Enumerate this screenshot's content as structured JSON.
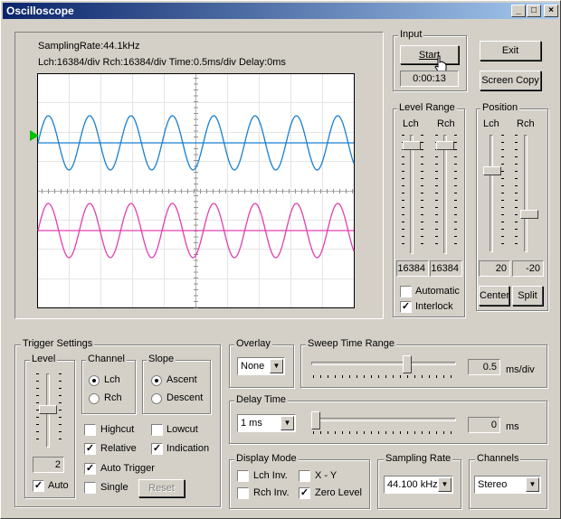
{
  "window": {
    "title": "Oscilloscope"
  },
  "titlebar_buttons": {
    "minimize": "_",
    "maximize": "□",
    "close": "×"
  },
  "scope": {
    "line1": "SamplingRate:44.1kHz",
    "line2": "Lch:16384/div  Rch:16384/div  Time:0.5ms/div  Delay:0ms",
    "colors": {
      "lch": "#1a7fd0",
      "rch": "#e040b0",
      "trigger_marker": "#00c000"
    }
  },
  "input": {
    "label": "Input",
    "start_button": "Start",
    "elapsed": "0:00:13"
  },
  "actions": {
    "exit_button": "Exit",
    "screen_copy_button": "Screen Copy"
  },
  "level_range": {
    "label": "Level Range",
    "lch_label": "Lch",
    "rch_label": "Rch",
    "lch_value": "16384",
    "rch_value": "16384",
    "automatic_label": "Automatic",
    "automatic_checked": false,
    "interlock_label": "Interlock",
    "interlock_checked": true
  },
  "position": {
    "label": "Position",
    "lch_label": "Lch",
    "rch_label": "Rch",
    "lch_value": "20",
    "rch_value": "-20",
    "center_button": "Center",
    "split_button": "Split"
  },
  "trigger": {
    "label": "Trigger Settings",
    "level_label": "Level",
    "level_value": "2",
    "auto_label": "Auto",
    "auto_checked": true,
    "channel_label": "Channel",
    "lch_label": "Lch",
    "rch_label": "Rch",
    "channel_selected": "Lch",
    "slope_label": "Slope",
    "ascent_label": "Ascent",
    "descent_label": "Descent",
    "slope_selected": "Ascent",
    "highcut_label": "Highcut",
    "highcut_checked": false,
    "lowcut_label": "Lowcut",
    "lowcut_checked": false,
    "relative_label": "Relative",
    "relative_checked": true,
    "indication_label": "Indication",
    "indication_checked": true,
    "auto_trigger_label": "Auto Trigger",
    "auto_trigger_checked": true,
    "single_label": "Single",
    "single_checked": false,
    "reset_button": "Reset"
  },
  "overlay": {
    "label": "Overlay",
    "value": "None"
  },
  "sweep_time": {
    "label": "Sweep Time Range",
    "value": "0.5",
    "unit": "ms/div"
  },
  "delay_time": {
    "label": "Delay Time",
    "combo_value": "1 ms",
    "value": "0",
    "unit": "ms"
  },
  "display_mode": {
    "label": "Display Mode",
    "lch_inv_label": "Lch Inv.",
    "lch_inv_checked": false,
    "rch_inv_label": "Rch Inv.",
    "rch_inv_checked": false,
    "xy_label": "X - Y",
    "xy_checked": false,
    "zero_level_label": "Zero Level",
    "zero_level_checked": true
  },
  "sampling_rate": {
    "label": "Sampling Rate",
    "value": "44.100 kHz"
  },
  "channels": {
    "label": "Channels",
    "value": "Stereo"
  },
  "icons": {
    "combo_arrow": "▼",
    "check_mark": "✓",
    "cursor": "hand-cursor-icon"
  }
}
